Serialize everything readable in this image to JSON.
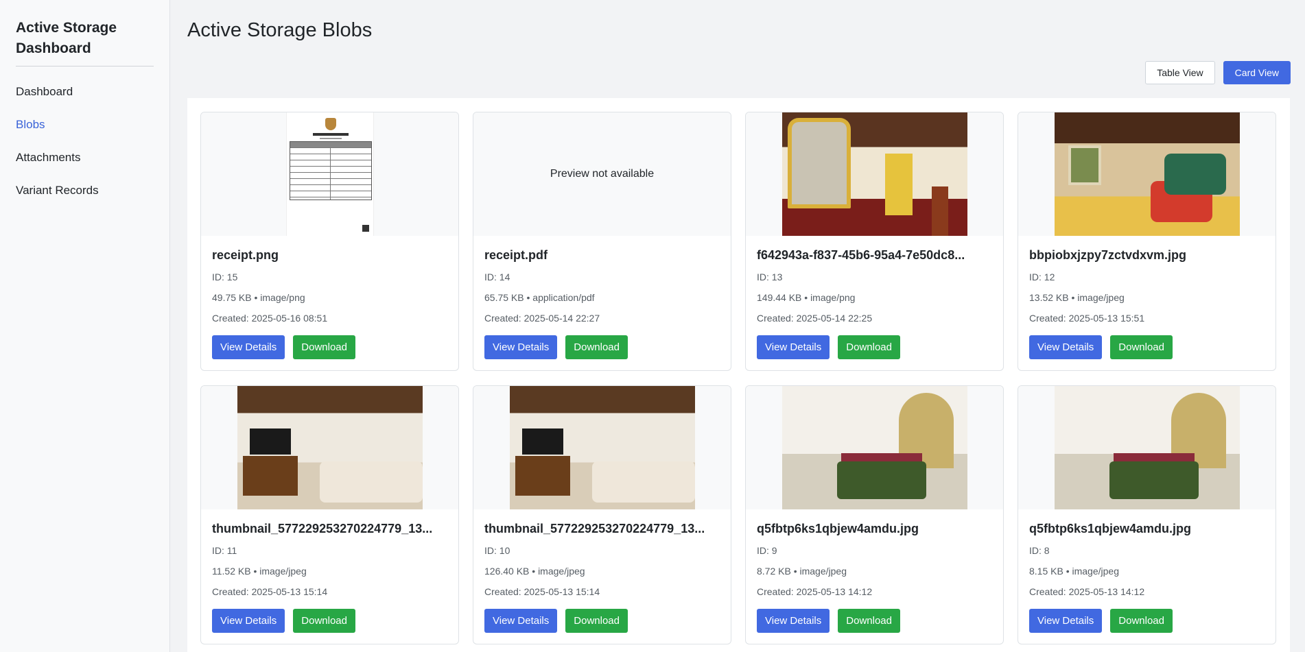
{
  "sidebar": {
    "brand": "Active Storage Dashboard",
    "items": [
      {
        "label": "Dashboard",
        "active": false
      },
      {
        "label": "Blobs",
        "active": true
      },
      {
        "label": "Attachments",
        "active": false
      },
      {
        "label": "Variant Records",
        "active": false
      }
    ]
  },
  "main": {
    "title": "Active Storage Blobs",
    "view_toggle": {
      "table": "Table View",
      "card": "Card View",
      "selected": "card"
    }
  },
  "actions": {
    "view": "View Details",
    "download": "Download"
  },
  "preview_missing": "Preview not available",
  "blobs": [
    {
      "filename": "receipt.png",
      "id": "ID: 15",
      "meta": "49.75 KB • image/png",
      "created": "Created: 2025-05-16 08:51",
      "preview": "document"
    },
    {
      "filename": "receipt.pdf",
      "id": "ID: 14",
      "meta": "65.75 KB • application/pdf",
      "created": "Created: 2025-05-14 22:27",
      "preview": "none"
    },
    {
      "filename": "f642943a-f837-45b6-95a4-7e50dc8...",
      "id": "ID: 13",
      "meta": "149.44 KB • image/png",
      "created": "Created: 2025-05-14 22:25",
      "preview": "living-room-mirror"
    },
    {
      "filename": "bbpiobxjzpy7zctvdxvm.jpg",
      "id": "ID: 12",
      "meta": "13.52 KB • image/jpeg",
      "created": "Created: 2025-05-13 15:51",
      "preview": "living-room-sofa"
    },
    {
      "filename": "thumbnail_577229253270224779_13...",
      "id": "ID: 11",
      "meta": "11.52 KB • image/jpeg",
      "created": "Created: 2025-05-13 15:14",
      "preview": "bedroom-tv"
    },
    {
      "filename": "thumbnail_577229253270224779_13...",
      "id": "ID: 10",
      "meta": "126.40 KB • image/jpeg",
      "created": "Created: 2025-05-13 15:14",
      "preview": "bedroom-tv"
    },
    {
      "filename": "q5fbtp6ks1qbjew4amdu.jpg",
      "id": "ID: 9",
      "meta": "8.72 KB • image/jpeg",
      "created": "Created: 2025-05-13 14:12",
      "preview": "bedroom-green"
    },
    {
      "filename": "q5fbtp6ks1qbjew4amdu.jpg",
      "id": "ID: 8",
      "meta": "8.15 KB • image/jpeg",
      "created": "Created: 2025-05-13 14:12",
      "preview": "bedroom-green"
    }
  ]
}
